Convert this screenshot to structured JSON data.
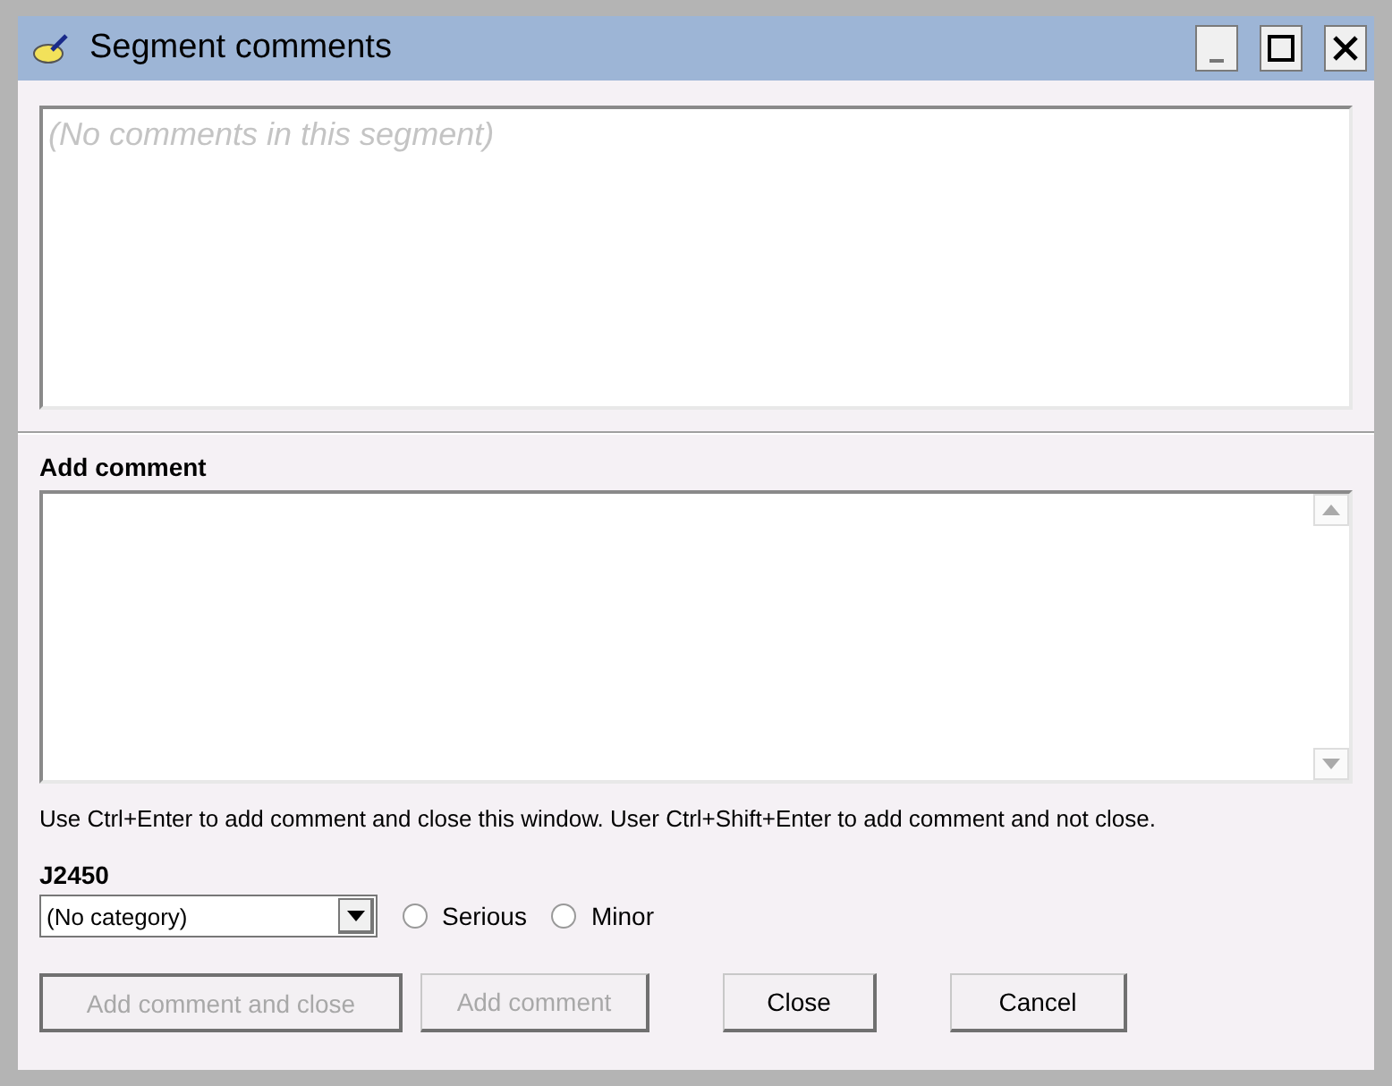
{
  "window": {
    "title": "Segment comments"
  },
  "comments": {
    "placeholder": "(No comments in this segment)"
  },
  "add_comment": {
    "label": "Add comment"
  },
  "hint": "Use Ctrl+Enter to add comment and close this window. User Ctrl+Shift+Enter to add comment and not close.",
  "category": {
    "label": "J2450",
    "value": "(No category)"
  },
  "severity": [
    {
      "label": "Serious",
      "selected": false
    },
    {
      "label": "Minor",
      "selected": false
    }
  ],
  "buttons": [
    {
      "label": "Add comment and close",
      "disabled": true,
      "default": true
    },
    {
      "label": "Add comment",
      "disabled": true,
      "default": false
    },
    {
      "label": "Close",
      "disabled": false,
      "default": false
    },
    {
      "label": "Cancel",
      "disabled": false,
      "default": false
    }
  ]
}
